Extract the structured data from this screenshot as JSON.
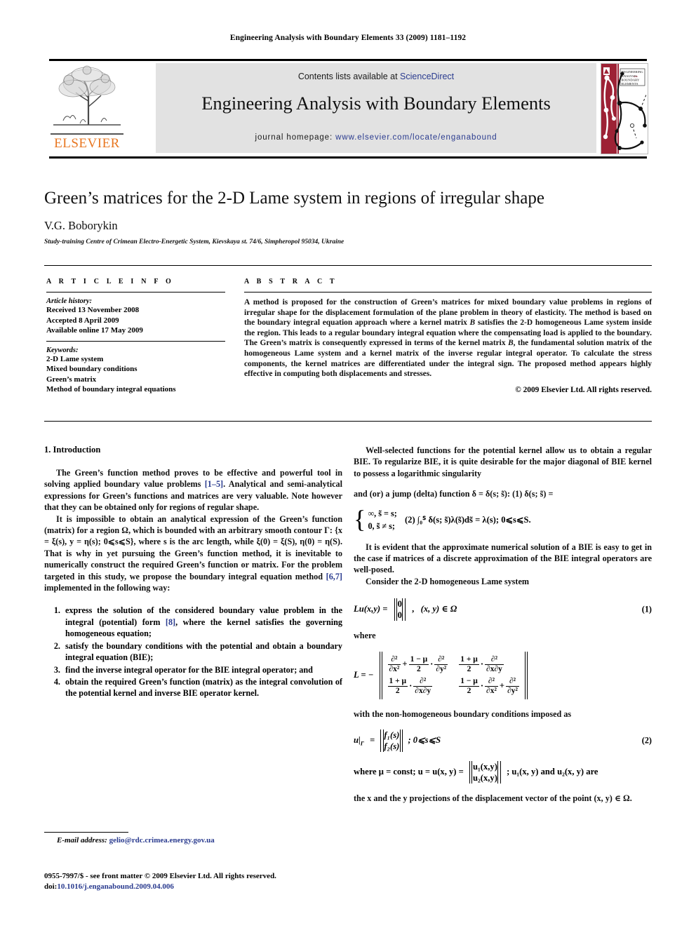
{
  "running_head": "Engineering Analysis with Boundary Elements 33 (2009) 1181–1192",
  "masthead": {
    "contents_prefix": "Contents lists available at ",
    "contents_link": "ScienceDirect",
    "journal_title": "Engineering Analysis with Boundary Elements",
    "homepage_prefix": "journal homepage: ",
    "homepage_link": "www.elsevier.com/locate/enganabound",
    "publisher_wordmark": "ELSEVIER",
    "publisher_color": "#E87722",
    "link_color": "#2a3b8f",
    "banner_bg": "#e2e2e2",
    "cover_band_color": "#9d2235",
    "cover_title_lines": [
      "ENGINEERING",
      "ANALYSIS with",
      "BOUNDARY",
      "ELEMENTS"
    ]
  },
  "article": {
    "title": "Green’s matrices for the 2-D Lame system in regions of irregular shape",
    "author": "V.G. Boborykin",
    "affiliation": "Study-training Centre of Crimean Electro-Energetic System, Kievskaya st. 74/6, Simpheropol 95034, Ukraine"
  },
  "info": {
    "heading": "A R T I C L E   I N F O",
    "history_label": "Article history:",
    "history": [
      "Received 13 November 2008",
      "Accepted 8 April 2009",
      "Available online 17 May 2009"
    ],
    "keywords_label": "Keywords:",
    "keywords": [
      "2-D Lame system",
      "Mixed boundary conditions",
      "Green’s matrix",
      "Method of boundary integral equations"
    ]
  },
  "abstract": {
    "heading": "A B S T R A C T",
    "body_1": "A method is proposed for the construction of Green’s matrices for mixed boundary value problems in regions of irregular shape for the displacement formulation of the plane problem in theory of elasticity. The method is based on the boundary integral equation approach where a kernel matrix ",
    "kernel_symbol_1": "B",
    "body_2": " satisfies the 2-D homogeneous Lame system inside the region. This leads to a regular boundary integral equation where the compensating load is applied to the boundary. The Green’s matrix is consequently expressed in terms of the kernel matrix ",
    "kernel_symbol_2": "B",
    "body_3": ", the fundamental solution matrix of the homogeneous Lame system and a kernel matrix of the inverse regular integral operator. To calculate the stress components, the kernel matrices are differentiated under the integral sign. The proposed method appears highly effective in computing both displacements and stresses.",
    "copyright": "© 2009 Elsevier Ltd. All rights reserved."
  },
  "sections": {
    "intro_heading": "1.  Introduction",
    "left_p1_a": "The Green’s function method proves to be effective and powerful tool in solving applied boundary value problems ",
    "left_p1_ref": "[1–5]",
    "left_p1_b": ". Analytical and semi-analytical expressions for Green’s functions and matrices are very valuable. Note however that they can be obtained only for regions of regular shape.",
    "left_p2_a": "It is impossible to obtain an analytical expression of the Green’s function (matrix) for a region Ω, which is bounded with an arbitrary smooth contour Γ: {x = ξ(s), y = η(s); 0⩽s⩽S}, where s is the arc length, while ξ(0) = ξ(S), η(0) = η(S). That is why in yet pursuing the Green’s function method, it is inevitable to numerically construct the required Green’s function or matrix. For the problem targeted in this study, we propose the boundary integral equation method ",
    "left_p2_ref": "[6,7]",
    "left_p2_b": " implemented in the following way:",
    "steps": [
      {
        "a": "express the solution of the considered boundary value problem in the integral (potential) form ",
        "ref": "[8]",
        "b": ", where the kernel satisfies the governing homogeneous equation;"
      },
      {
        "a": "satisfy the boundary conditions with the potential and obtain a boundary integral equation (BIE);",
        "ref": "",
        "b": ""
      },
      {
        "a": "find the inverse integral operator for the BIE integral operator; and",
        "ref": "",
        "b": ""
      },
      {
        "a": "obtain the required Green’s function (matrix) as the integral convolution of the potential kernel and inverse BIE operator kernel.",
        "ref": "",
        "b": ""
      }
    ],
    "right_p1": "Well-selected functions for the potential kernel allow us to obtain a regular BIE. To regularize BIE, it is quite desirable for the major diagonal of BIE kernel to possess a logarithmic singularity",
    "right_p2_inline": "and (or) a jump (delta) function δ = δ(s; s̃):  (1)  δ(s; s̃) =",
    "delta_cases": [
      "∞,     s̃ = s;",
      "0,      s̃ ≠ s;"
    ],
    "delta_second": "(2) ∫₀ᔆ δ(s; s̃)λ(s̃)ds̃ = λ(s); 0⩽s⩽S.",
    "right_p3": "It is evident that the approximate numerical solution of a BIE is easy to get in the case if matrices of a discrete approximation of the BIE integral operators are well-posed.",
    "right_p4": "Consider the 2-D homogeneous Lame system",
    "eq1_lhs": "Lu(x,y) =",
    "eq1_vec": [
      "0",
      "0"
    ],
    "eq1_domain": "(x, y) ∈ Ω",
    "eq1_number": "(1)",
    "where_label_1": "where",
    "L_lhs": "L = −",
    "L_entries": {
      "r1c1_a": "∂²",
      "r1c1_b": "∂x²",
      "r1c1_plus": "+",
      "r1c1_fr_num": "1 − μ",
      "r1c1_fr_den": "2",
      "r1c1_dot": "·",
      "r1c1_c": "∂²",
      "r1c1_d": "∂y²",
      "r1c2_fr_num": "1 + μ",
      "r1c2_fr_den": "2",
      "r1c2_dot": "·",
      "r1c2_a": "∂²",
      "r1c2_b": "∂x∂y",
      "r2c1_fr_num": "1 + μ",
      "r2c1_fr_den": "2",
      "r2c1_dot": "·",
      "r2c1_a": "∂²",
      "r2c1_b": "∂x∂y",
      "r2c2_fr_num": "1 − μ",
      "r2c2_fr_den": "2",
      "r2c2_dot": "·",
      "r2c2_a": "∂²",
      "r2c2_b": "∂x²",
      "r2c2_plus": "+",
      "r2c2_c": "∂²",
      "r2c2_d": "∂y²"
    },
    "bc_intro": "with the non-homogeneous boundary conditions imposed as",
    "eq2_lhs": "u|",
    "eq2_lhs_sub": "Γ",
    "eq2_eq": "=",
    "eq2_vec": [
      "f₁(s)",
      "f₂(s)"
    ],
    "eq2_range": "; 0⩽s⩽S",
    "eq2_number": "(2)",
    "eq2_after_a": "where μ = const; u = u(x, y) =",
    "eq2_after_vec": [
      "u₁(x,y)",
      "u₂(x,y)"
    ],
    "eq2_after_b": "; u₁(x, y) and u₂(x, y) are",
    "eq2_after_c": "the x and the y projections of the displacement vector of the point (x, y) ∈ Ω."
  },
  "footer": {
    "email_label": "E-mail address:",
    "email": "gelio@rdc.crimea.energy.gov.ua",
    "issn_line": "0955-7997/$ - see front matter © 2009 Elsevier Ltd. All rights reserved.",
    "doi_label": "doi:",
    "doi": "10.1016/j.enganabound.2009.04.006"
  }
}
